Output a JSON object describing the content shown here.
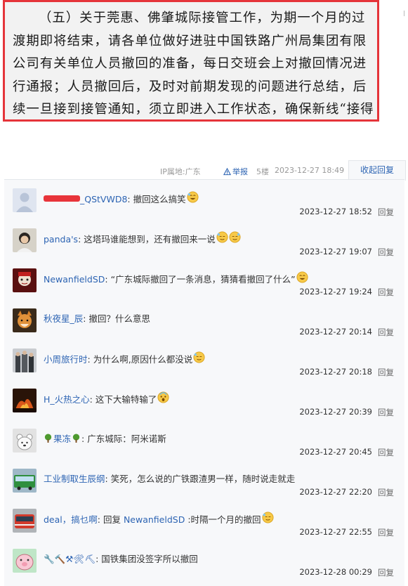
{
  "document": {
    "text": "（五）关于莞惠、佛肇城际接管工作，为期一个月的过渡期即将结束，请各单位做好进驻中国铁路广州局集团有限公司有关单位人员撤回的准备，每日交班会上对撤回情况进行通报；人员撤回后，及时对前期发现的问题进行总结，后续一旦接到接管通知，须立即进入工作状态，确保新线“接得好、接得住、接得稳”。"
  },
  "post_meta": {
    "ip": "IP属地:广东",
    "report": "举报",
    "floor": "5楼",
    "time": "2023-12-27 18:49",
    "collapse": "收起回复"
  },
  "comments": [
    {
      "user": "_QStVWD8",
      "sep": ":",
      "text": "撤回这么搞笑",
      "time": "2023-12-27 18:52",
      "reply": "回复"
    },
    {
      "user": "panda's",
      "sep": ":",
      "text": "这塔玛谁能想到，还有撤回来一说",
      "time": "2023-12-27 19:07",
      "reply": "回复"
    },
    {
      "user": "NewanfieldSD",
      "sep": ":",
      "text": "“广东城际撤回了一条消息，猜猜看撤回了什么”",
      "time": "2023-12-27 19:24",
      "reply": "回复"
    },
    {
      "user": "秋夜星_辰",
      "sep": ":",
      "text": "撤回？什么意思",
      "time": "2023-12-27 20:14",
      "reply": "回复"
    },
    {
      "user": "小周旅行时",
      "sep": ":",
      "text": "为什么啊,原因什么都没说",
      "time": "2023-12-27 20:18",
      "reply": "回复"
    },
    {
      "user": "H_火热之心",
      "sep": ":",
      "text": "这下大输特输了",
      "time": "2023-12-27 20:39",
      "reply": "回复"
    },
    {
      "user": "果冻",
      "sep": ":",
      "text": "广东城际：阿米诺斯",
      "time": "2023-12-27 20:45",
      "reply": "回复"
    },
    {
      "user": "工业制取生辰纲",
      "sep": ":",
      "text": "笑死，怎么说的广铁跟渣男一样，随时说走就走",
      "time": "2023-12-27 22:20",
      "reply": "回复"
    },
    {
      "user": "deal，搞乜啊",
      "sep": ":",
      "text": "回复 ",
      "mention": "NewanfieldSD",
      "text2": " :时隔一个月的撤回",
      "time": "2023-12-27 22:55",
      "reply": "回复"
    },
    {
      "user": "🔧🔨⚒🛠⛏",
      "sep": ":",
      "text": "国铁集团没签字所以撤回",
      "time": "2023-12-28 00:29",
      "reply": "回复"
    }
  ]
}
